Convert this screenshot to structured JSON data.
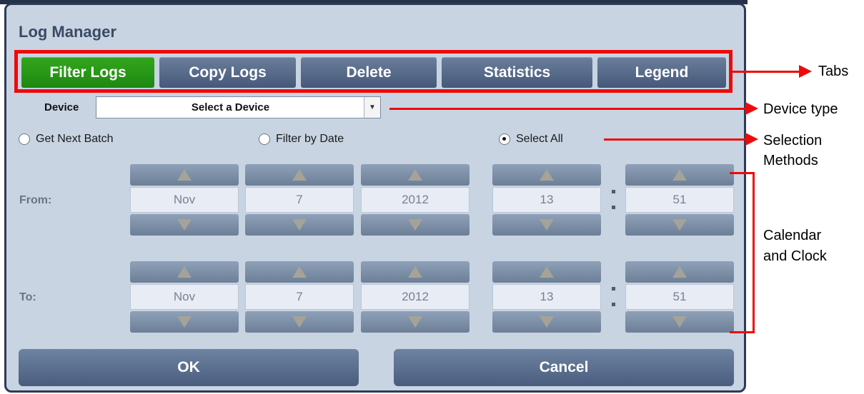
{
  "dialog": {
    "title": "Log Manager",
    "tabs": [
      {
        "label": "Filter Logs",
        "active": true
      },
      {
        "label": "Copy Logs",
        "active": false
      },
      {
        "label": "Delete",
        "active": false
      },
      {
        "label": "Statistics",
        "active": false
      },
      {
        "label": "Legend",
        "active": false
      }
    ],
    "device": {
      "label": "Device",
      "value": "Select a Device"
    },
    "selection": [
      {
        "label": "Get Next Batch",
        "selected": false
      },
      {
        "label": "Filter by Date",
        "selected": false
      },
      {
        "label": "Select All",
        "selected": true
      }
    ],
    "from": {
      "label": "From:",
      "month": "Nov",
      "day": "7",
      "year": "2012",
      "hour": "13",
      "minute": "51"
    },
    "to": {
      "label": "To:",
      "month": "Nov",
      "day": "7",
      "year": "2012",
      "hour": "13",
      "minute": "51"
    },
    "ok_label": "OK",
    "cancel_label": "Cancel"
  },
  "callouts": {
    "tabs": "Tabs",
    "device_type": "Device type",
    "selection_line1": "Selection",
    "selection_line2": "Methods",
    "calendar_line1": "Calendar",
    "calendar_line2": "and Clock"
  },
  "colors": {
    "annotation": "#ee0a0a",
    "dialog_bg": "#c8d4e2",
    "active_tab": "#2a9a18",
    "button": "#5a6e8e"
  },
  "icons": {
    "spin_up": "triangle-up",
    "spin_down": "triangle-down",
    "dropdown": "caret-down"
  }
}
